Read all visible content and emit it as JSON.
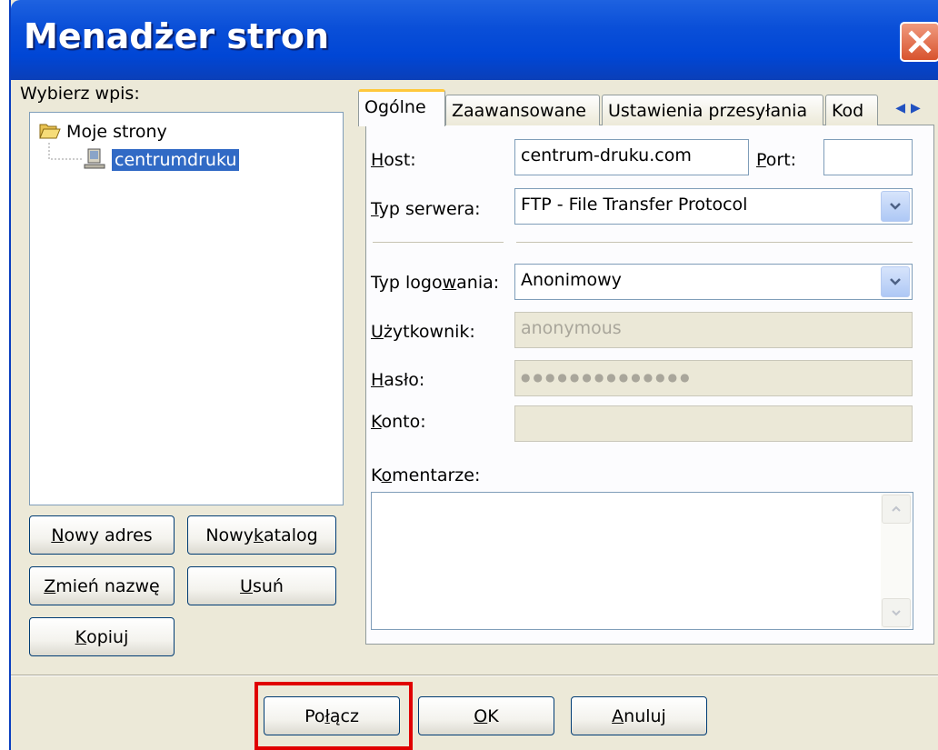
{
  "window": {
    "title": "Menadżer stron",
    "close_icon": "close-icon"
  },
  "site_list": {
    "label": "Wybierz wpis:",
    "root": {
      "label": "Moje strony",
      "icon": "folder-open-icon"
    },
    "items": [
      {
        "label": "centrumdruku",
        "icon": "computer-icon",
        "selected": true
      }
    ]
  },
  "buttons": {
    "new_site": {
      "mn": "N",
      "rest": "owy adres"
    },
    "new_folder": {
      "pre": "Nowy ",
      "mn": "k",
      "rest": "atalog"
    },
    "rename": {
      "mn": "Z",
      "rest": "mień nazwę"
    },
    "delete": {
      "mn": "U",
      "rest": "suń"
    },
    "copy": {
      "mn": "K",
      "rest": "opiuj"
    }
  },
  "tabs": [
    {
      "label": "Ogólne",
      "active": true
    },
    {
      "label": "Zaawansowane"
    },
    {
      "label": "Ustawienia przesyłania"
    },
    {
      "label": "Kod"
    }
  ],
  "general": {
    "host": {
      "mn": "H",
      "rest": "ost:",
      "value": "centrum-druku.com"
    },
    "port": {
      "mn": "P",
      "rest": "ort:",
      "value": ""
    },
    "server_type": {
      "mn": "T",
      "rest": "yp serwera:",
      "value": "FTP - File Transfer Protocol"
    },
    "logon_type": {
      "pre": "Typ logo",
      "mn": "w",
      "rest": "ania:",
      "value": "Anonimowy"
    },
    "user": {
      "mn": "U",
      "rest": "żytkownik:",
      "value": "anonymous"
    },
    "password": {
      "mn": "H",
      "rest": "asło:",
      "value": "●●●●●●●●●●●●●●"
    },
    "account": {
      "mn": "K",
      "rest": "onto:",
      "value": ""
    },
    "comments": {
      "pre": "K",
      "mn": "o",
      "rest": "mentarze:",
      "value": ""
    }
  },
  "footer": {
    "connect": {
      "pre": "Po",
      "mn": "ł",
      "rest": "ącz"
    },
    "ok": {
      "mn": "O",
      "rest": "K"
    },
    "cancel": {
      "mn": "A",
      "rest": "nuluj"
    }
  },
  "colors": {
    "title_bar": "#0a4fd8",
    "highlight": "#e00000",
    "selection": "#316ac5",
    "tab_accent": "#ffc83c"
  }
}
